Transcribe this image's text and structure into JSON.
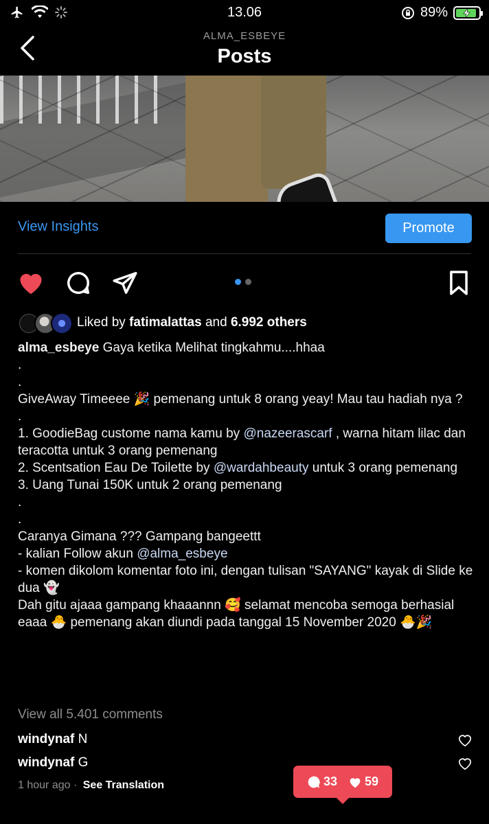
{
  "status_bar": {
    "time": "13.06",
    "battery_percent": "89%",
    "icons": [
      "airplane-icon",
      "wifi-icon",
      "loading-spinner-icon",
      "orientation-lock-icon",
      "battery-charging-icon"
    ]
  },
  "header": {
    "account": "ALMA_ESBEYE",
    "title": "Posts",
    "back_icon": "chevron-left-icon"
  },
  "actions": {
    "view_insights": "View Insights",
    "promote": "Promote"
  },
  "post_icons": [
    "heart-filled-icon",
    "comment-icon",
    "share-icon",
    "bookmark-icon"
  ],
  "carousel": {
    "total": 2,
    "current": 1
  },
  "likes": {
    "prefix": "Liked by",
    "user": "fatimalattas",
    "connector": "and",
    "others": "6.992 others"
  },
  "caption": {
    "username": "alma_esbeye",
    "first_line": "Gaya ketika Melihat tingkahmu....hhaa",
    "lines": [
      ".",
      ".",
      "GiveAway Timeeee 🎉 pemenang untuk 8 orang yeay! Mau tau hadiah nya ?",
      ".",
      "1. GoodieBag custome nama kamu by @nazeerascarf , warna hitam lilac dan teracotta untuk 3 orang pemenang",
      "2. Scentsation Eau De Toilette by @wardahbeauty untuk 3 orang pemenang",
      "3. Uang Tunai 150K untuk 2 orang pemenang",
      ".",
      ".",
      "Caranya Gimana ??? Gampang bangeettt",
      "- kalian Follow akun @alma_esbeye",
      "- komen dikolom komentar foto ini, dengan tulisan \"SAYANG\" kayak di Slide ke dua 👻",
      "Dah gitu ajaaa gampang khaaannn 🥰 selamat mencoba semoga berhasial eaaa 🐣 pemenang akan diundi pada tanggal 15 November 2020 🐣🎉"
    ]
  },
  "comments_link": "View all 5.401 comments",
  "comments": [
    {
      "user": "windynaf",
      "text": "N"
    },
    {
      "user": "windynaf",
      "text": "G"
    }
  ],
  "meta": {
    "time_ago": "1 hour ago",
    "separator": "·",
    "see_translation": "See Translation"
  },
  "notification": {
    "comments": "33",
    "likes": "59",
    "color": "#ed4956"
  },
  "colors": {
    "accent": "#3897f0",
    "like_red": "#ed4956",
    "muted": "#8e8e8e"
  }
}
